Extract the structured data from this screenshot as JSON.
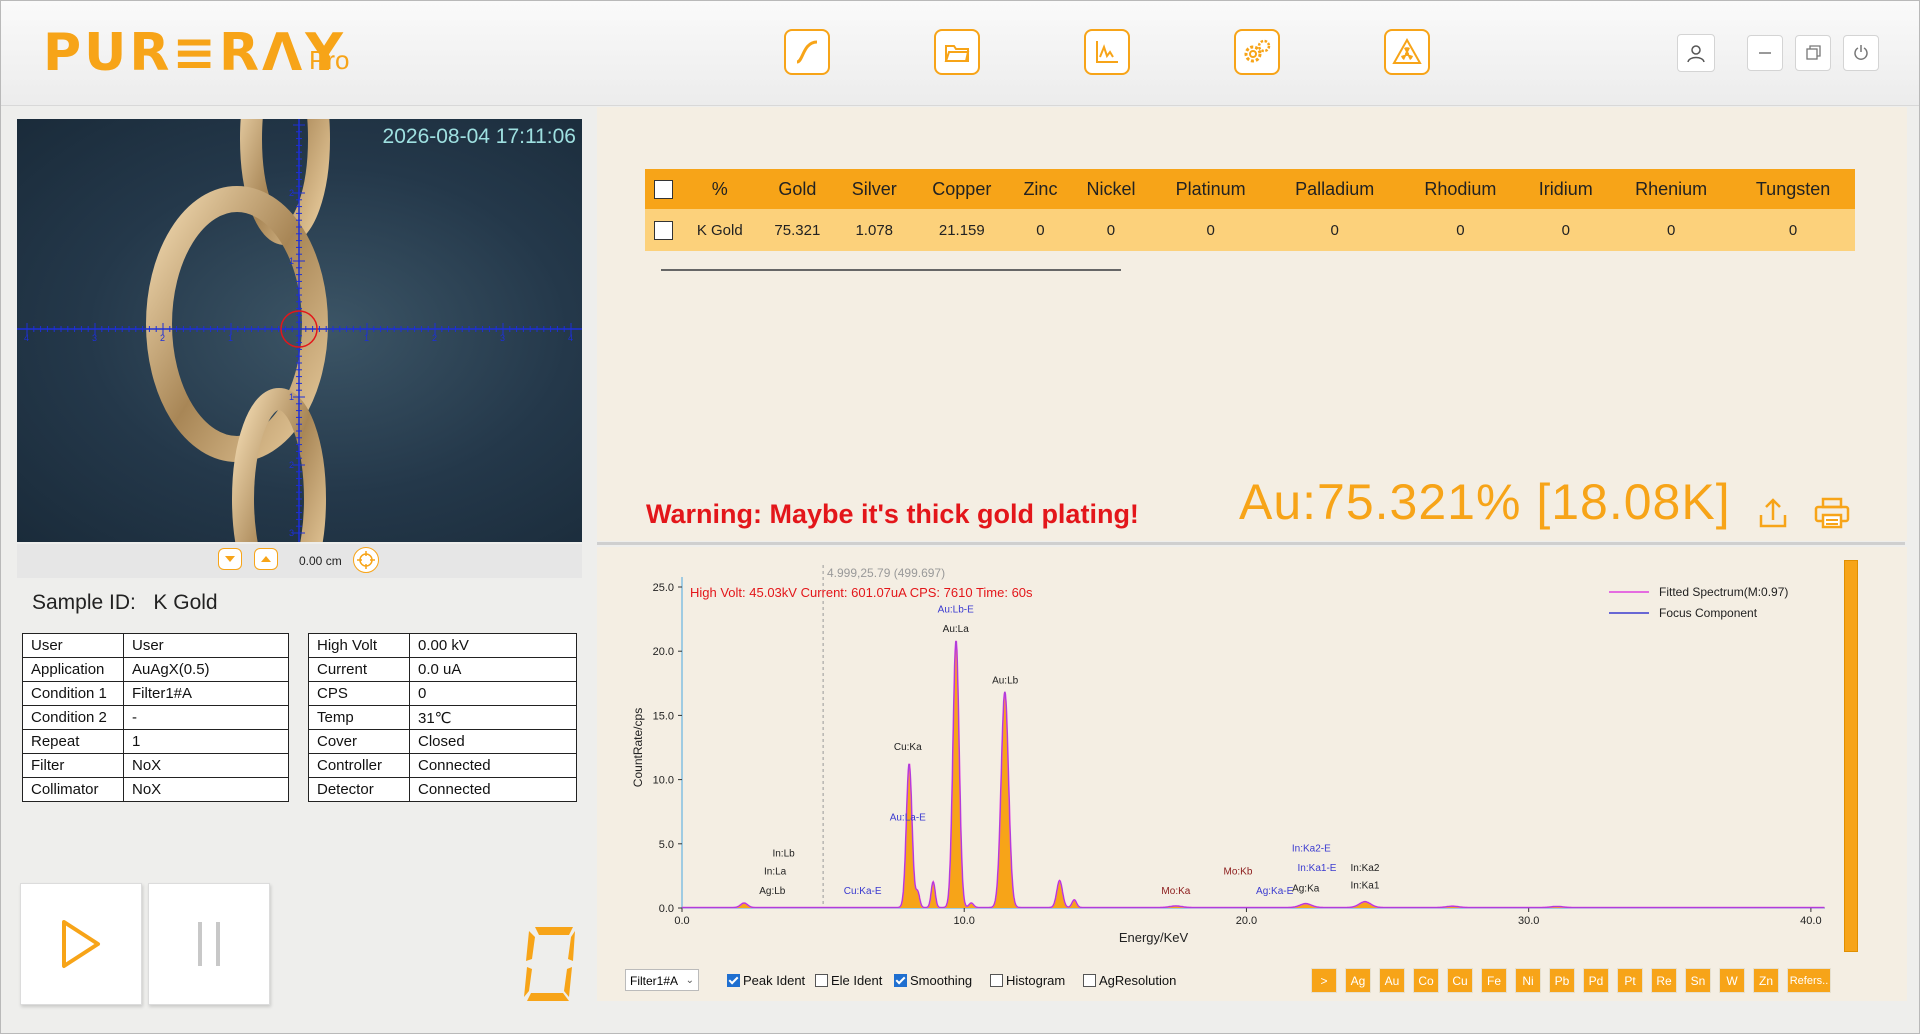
{
  "header": {
    "logo": "PUR≡RΛY",
    "logo_suffix": "Pro",
    "tools": [
      "curve-icon",
      "folder-icon",
      "chart-icon",
      "settings-icon",
      "radiation-icon"
    ],
    "window_controls": [
      "user-icon",
      "minimize-icon",
      "restore-icon",
      "power-icon"
    ]
  },
  "camera": {
    "timestamp": "2026-08-04 17:11:06",
    "distance": "0.00 cm",
    "h_ticks": [
      "4",
      "3",
      "2",
      "1",
      "1",
      "2",
      "3",
      "4"
    ],
    "v_ticks": [
      "2",
      "1",
      "1",
      "2",
      "3"
    ]
  },
  "sample": {
    "label": "Sample ID:",
    "value": "K Gold"
  },
  "info_left": [
    {
      "key": "User",
      "value": "User"
    },
    {
      "key": "Application",
      "value": "AuAgX(0.5)"
    },
    {
      "key": "Condition 1",
      "value": "Filter1#A"
    },
    {
      "key": "Condition 2",
      "value": "-"
    },
    {
      "key": "Repeat",
      "value": "1"
    },
    {
      "key": "Filter",
      "value": "NoX"
    },
    {
      "key": "Collimator",
      "value": "NoX"
    }
  ],
  "info_right": [
    {
      "key": "High Volt",
      "value": "0.00 kV"
    },
    {
      "key": "Current",
      "value": "0.0 uA"
    },
    {
      "key": "CPS",
      "value": "0"
    },
    {
      "key": "Temp",
      "value": "31℃"
    },
    {
      "key": "Cover",
      "value": "Closed"
    },
    {
      "key": "Controller",
      "value": "Connected"
    },
    {
      "key": "Detector",
      "value": "Connected"
    }
  ],
  "result_table": {
    "headers": [
      "%",
      "Gold",
      "Silver",
      "Copper",
      "Zinc",
      "Nickel",
      "Platinum",
      "Palladium",
      "Rhodium",
      "Iridium",
      "Rhenium",
      "Tungsten"
    ],
    "rows": [
      {
        "name": "K Gold",
        "values": [
          "75.321",
          "1.078",
          "21.159",
          "0",
          "0",
          "0",
          "0",
          "0",
          "0",
          "0",
          "0"
        ]
      }
    ]
  },
  "warning": "Warning: Maybe it's thick gold plating!",
  "au_result": "Au:75.321%  [18.08K]",
  "status_digit": "0",
  "chart_data": {
    "type": "line",
    "cursor_readout": "4.999,25.79 (499.697)",
    "info_line": "High Volt: 45.03kV  Current: 601.07uA  CPS: 7610  Time: 60s",
    "xlabel": "Energy/KeV",
    "ylabel": "CountRate/cps",
    "xlim": [
      0,
      40.5
    ],
    "ylim": [
      0,
      25
    ],
    "x_ticks": [
      "0.0",
      "10.0",
      "20.0",
      "30.0",
      "40.0"
    ],
    "y_ticks": [
      "0.0",
      "5.0",
      "10.0",
      "15.0",
      "20.0",
      "25.0"
    ],
    "legend": [
      "Fitted Spectrum(M:0.97)",
      "Focus Component"
    ],
    "legend_position": "top-right",
    "colors": {
      "fitted": "#e040e0",
      "focus": "#3a3ad0",
      "fill": "#f7a418",
      "axis": "#4aa8e0",
      "info": "#e3161a"
    },
    "peaks": [
      {
        "x": 2.2,
        "y": 0.35,
        "w": 0.12
      },
      {
        "x": 8.05,
        "y": 11.2,
        "w": 0.1
      },
      {
        "x": 8.35,
        "y": 1.2,
        "w": 0.07
      },
      {
        "x": 8.9,
        "y": 2.0,
        "w": 0.07
      },
      {
        "x": 9.71,
        "y": 20.8,
        "w": 0.11
      },
      {
        "x": 10.25,
        "y": 0.35,
        "w": 0.08
      },
      {
        "x": 11.44,
        "y": 16.8,
        "w": 0.13
      },
      {
        "x": 13.38,
        "y": 2.1,
        "w": 0.1
      },
      {
        "x": 13.9,
        "y": 0.6,
        "w": 0.08
      },
      {
        "x": 17.5,
        "y": 0.12,
        "w": 0.2
      },
      {
        "x": 22.1,
        "y": 0.3,
        "w": 0.2
      },
      {
        "x": 24.2,
        "y": 0.45,
        "w": 0.2
      },
      {
        "x": 27.3,
        "y": 0.1,
        "w": 0.2
      },
      {
        "x": 31.0,
        "y": 0.08,
        "w": 0.2
      }
    ],
    "annotations": [
      {
        "text": "Au:Lb-E",
        "x": 9.7,
        "y": 23.0,
        "color": "#3a3ad0"
      },
      {
        "text": "Au:La",
        "x": 9.7,
        "y": 21.5,
        "color": "#222"
      },
      {
        "text": "Au:Lb",
        "x": 11.45,
        "y": 17.5,
        "color": "#222"
      },
      {
        "text": "Cu:Ka",
        "x": 8.0,
        "y": 12.3,
        "color": "#222"
      },
      {
        "text": "Au:La-E",
        "x": 8.0,
        "y": 6.8,
        "color": "#3a3ad0"
      },
      {
        "text": "In:Lb",
        "x": 3.6,
        "y": 4.0,
        "color": "#222"
      },
      {
        "text": "In:La",
        "x": 3.3,
        "y": 2.6,
        "color": "#222"
      },
      {
        "text": "Ag:Lb",
        "x": 3.2,
        "y": 1.1,
        "color": "#222"
      },
      {
        "text": "Cu:Ka-E",
        "x": 6.4,
        "y": 1.1,
        "color": "#3a3ad0"
      },
      {
        "text": "Mo:Ka",
        "x": 17.5,
        "y": 1.1,
        "color": "#8b1a1a"
      },
      {
        "text": "Mo:Kb",
        "x": 19.7,
        "y": 2.6,
        "color": "#8b1a1a"
      },
      {
        "text": "Ag:Ka-E",
        "x": 21.0,
        "y": 1.1,
        "color": "#3a3ad0"
      },
      {
        "text": "In:Ka2-E",
        "x": 22.3,
        "y": 4.4,
        "color": "#3a3ad0"
      },
      {
        "text": "In:Ka1-E",
        "x": 22.5,
        "y": 2.9,
        "color": "#3a3ad0"
      },
      {
        "text": "Ag:Ka",
        "x": 22.1,
        "y": 1.3,
        "color": "#222"
      },
      {
        "text": "In:Ka2",
        "x": 24.2,
        "y": 2.9,
        "color": "#222"
      },
      {
        "text": "In:Ka1",
        "x": 24.2,
        "y": 1.5,
        "color": "#222"
      }
    ]
  },
  "bottom_bar": {
    "filter_select": "Filter1#A",
    "checkboxes": [
      {
        "label": "Peak Ident",
        "checked": true
      },
      {
        "label": "Ele Ident",
        "checked": false
      },
      {
        "label": "Smoothing",
        "checked": true
      },
      {
        "label": "Histogram",
        "checked": false
      },
      {
        "label": "AgResolution",
        "checked": false
      }
    ],
    "element_buttons": [
      ">",
      "Ag",
      "Au",
      "Co",
      "Cu",
      "Fe",
      "Ni",
      "Pb",
      "Pd",
      "Pt",
      "Re",
      "Sn",
      "W",
      "Zn",
      "Refers.."
    ]
  }
}
